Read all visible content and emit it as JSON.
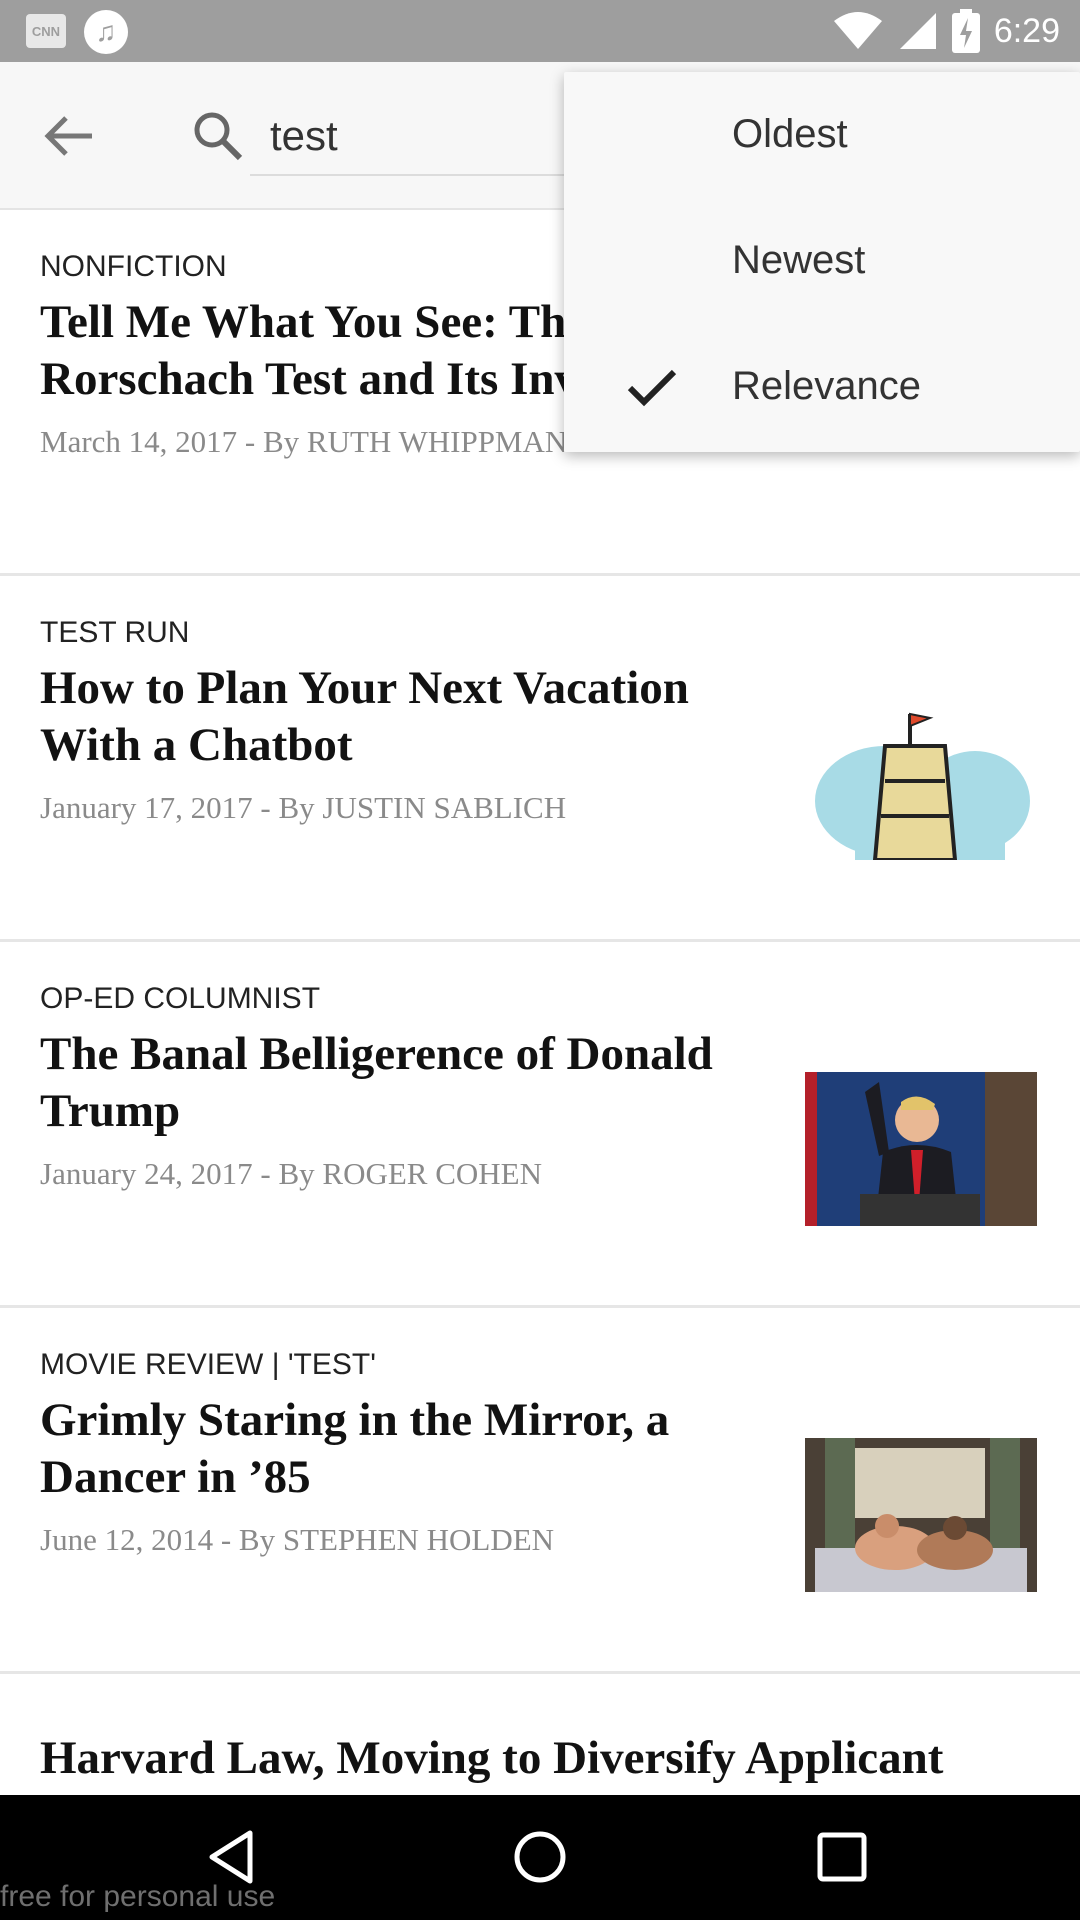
{
  "status_bar": {
    "time": "6:29",
    "notification_cnn": "CNN"
  },
  "toolbar": {
    "search_value": "test"
  },
  "sort_menu": {
    "items": [
      {
        "label": "Oldest",
        "selected": false
      },
      {
        "label": "Newest",
        "selected": false
      },
      {
        "label": "Relevance",
        "selected": true
      }
    ]
  },
  "articles": [
    {
      "kicker": "NONFICTION",
      "headline": "Tell Me What You See: The Rorschach Test and Its Inventor",
      "byline": "March 14, 2017 - By RUTH WHIPPMAN"
    },
    {
      "kicker": "TEST RUN",
      "headline": "How to Plan Your Next Vacation With a Chatbot",
      "byline": "January 17, 2017 - By JUSTIN SABLICH"
    },
    {
      "kicker": "OP-ED COLUMNIST",
      "headline": "The Banal Belligerence of Donald Trump",
      "byline": "January 24, 2017 - By ROGER COHEN"
    },
    {
      "kicker": "MOVIE REVIEW | 'TEST'",
      "headline": "Grimly Staring in the Mirror, a Dancer in ’85",
      "byline": "June 12, 2014 - By STEPHEN HOLDEN"
    },
    {
      "headline": "Harvard Law, Moving to Diversify Applicant Pool, Will Accept GRE Scores"
    }
  ],
  "watermark": "free for personal use",
  "colors": {
    "status_bar": "#9e9e9e",
    "toolbar": "#f7f7f7",
    "byline": "#8a8a8a",
    "nav_bar": "#000000"
  }
}
